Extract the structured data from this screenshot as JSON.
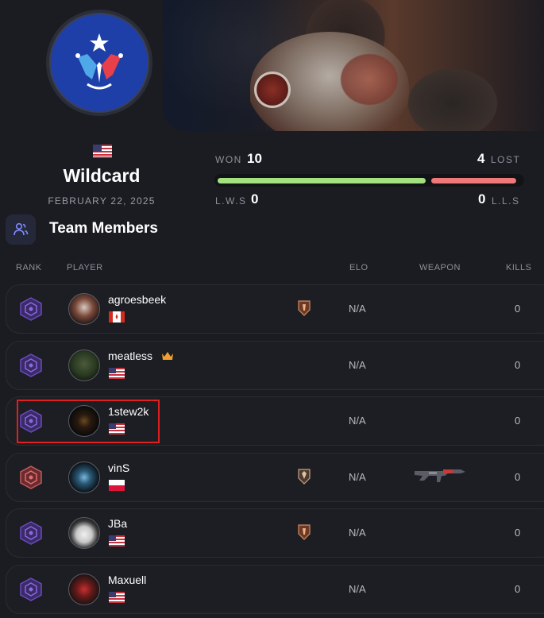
{
  "team": {
    "name": "Wildcard",
    "date": "FEBRUARY 22, 2025",
    "flag": "us-flag-icon",
    "logo": "wildcard-logo"
  },
  "stats": {
    "won_label": "WON",
    "won_value": "10",
    "lost_value": "4",
    "lost_label": "LOST",
    "lws_label": "L.W.S",
    "lws_value": "0",
    "lls_value": "0",
    "lls_label": "L.L.S",
    "won_color": "#a3e07f",
    "lost_color": "#f07878"
  },
  "section": {
    "title": "Team Members",
    "icon": "users-icon"
  },
  "table": {
    "headers": {
      "rank": "RANK",
      "player": "PLAYER",
      "elo": "ELO",
      "weapon": "WEAPON",
      "kills": "KILLS"
    },
    "rows": [
      {
        "name": "agroesbeek",
        "flag": "canada-flag-icon",
        "elo": "N/A",
        "kills": "0",
        "rank": "purple-rank-icon",
        "badge": true,
        "weapon": null
      },
      {
        "name": "meatless",
        "flag": "us-flag-icon",
        "elo": "N/A",
        "kills": "0",
        "rank": "purple-rank-icon",
        "crown": "crown-icon",
        "badge": false,
        "weapon": null
      },
      {
        "name": "1stew2k",
        "flag": "us-flag-icon",
        "elo": "N/A",
        "kills": "0",
        "rank": "purple-rank-icon",
        "badge": false,
        "weapon": null,
        "highlighted": true
      },
      {
        "name": "vinS",
        "flag": "poland-flag-icon",
        "elo": "N/A",
        "kills": "0",
        "rank": "red-rank-icon",
        "badge": true,
        "weapon": "rifle-icon"
      },
      {
        "name": "JBa",
        "flag": "us-flag-icon",
        "elo": "N/A",
        "kills": "0",
        "rank": "purple-rank-icon",
        "badge": true,
        "weapon": null
      },
      {
        "name": "Maxuell",
        "flag": "us-flag-icon",
        "elo": "N/A",
        "kills": "0",
        "rank": "purple-rank-icon",
        "badge": false,
        "weapon": null
      }
    ]
  }
}
